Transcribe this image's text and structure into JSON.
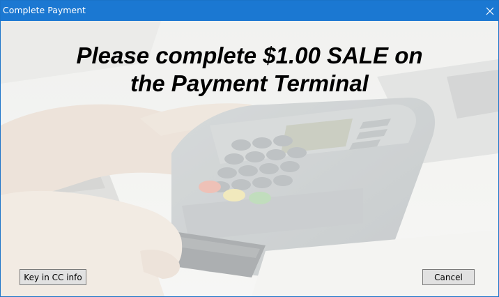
{
  "window": {
    "title": "Complete Payment",
    "close_icon": "close-icon"
  },
  "main": {
    "message_line1": "Please complete $1.00 SALE on",
    "message_line2": "the Payment Terminal",
    "background_image": "hand swiping card on payment terminal"
  },
  "buttons": {
    "key_in_label": "Key in CC info",
    "cancel_label": "Cancel"
  },
  "colors": {
    "titlebar": "#1b78d2",
    "message_text": "#000000"
  }
}
